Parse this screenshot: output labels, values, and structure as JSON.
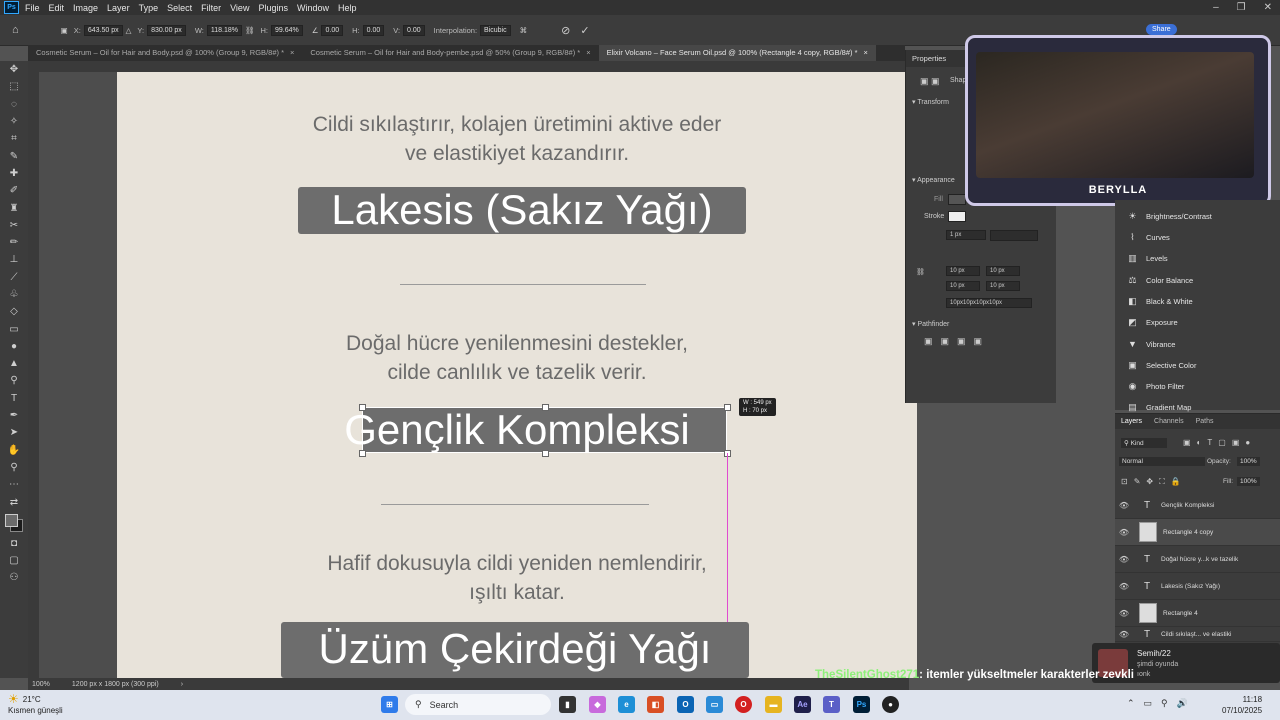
{
  "menu": [
    "File",
    "Edit",
    "Image",
    "Layer",
    "Type",
    "Select",
    "Filter",
    "View",
    "Plugins",
    "Window",
    "Help"
  ],
  "options": {
    "x_label": "X:",
    "x_value": "643.50 px",
    "y_label": "Y:",
    "y_value": "830.00 px",
    "w_label": "W:",
    "w_value": "118.18%",
    "h_label": "H:",
    "h_value": "99.64%",
    "angle_value": "0.00",
    "hskew_label": "H:",
    "hskew_value": "0.00",
    "vskew_label": "V:",
    "vskew_value": "0.00",
    "interp_label": "Interpolation:",
    "interp_value": "Bicubic"
  },
  "tabs": [
    {
      "label": "Cosmetic Serum – Oil for Hair and Body.psd @ 100% (Group 9, RGB/8#) *",
      "close": "×"
    },
    {
      "label": "Cosmetic Serum – Oil for Hair and Body-pembe.psd @ 50% (Group 9, RGB/8#) *",
      "close": "×"
    },
    {
      "label": "Elixir Volcano – Face Serum Oil.psd @ 100% (Rectangle 4 copy, RGB/8#) *",
      "close": "×"
    }
  ],
  "doc": {
    "p1_line1": "Cildi sıkılaştırır, kolajen üretimini aktive eder",
    "p1_line2": "ve elastikiyet kazandırır.",
    "h1": "Lakesis (Sakız Yağı)",
    "p2_line1": "Doğal hücre yenilenmesini destekler,",
    "p2_line2": "cilde canlılık ve tazelik verir.",
    "h2": "Gençlik Kompleksi",
    "p3_line1": "Hafif dokusuyla cildi yeniden nemlendirir,",
    "p3_line2": "ışıltı katar.",
    "h3": "Üzüm Çekirdeği Yağı",
    "size_w": "W : 549 px",
    "size_h": "H :  70 px"
  },
  "properties": {
    "tab": "Properties",
    "shape_label": "Shap",
    "transform": "Transform",
    "appearance": "Appearance",
    "fill": "Fill",
    "stroke": "Stroke",
    "stroke_width": "1 px",
    "corner1": "10 px",
    "corner2": "10 px",
    "corner3": "10 px",
    "corner4": "10 px",
    "corners_all": "10px10px10px10px",
    "pathfinder": "Pathfinder"
  },
  "adjustments": [
    "Brightness/Contrast",
    "Curves",
    "Levels",
    "Color Balance",
    "Black & White",
    "Exposure",
    "Vibrance",
    "Selective Color",
    "Photo Filter",
    "Gradient Map"
  ],
  "layers_panel": {
    "tabs": [
      "Layers",
      "Channels",
      "Paths"
    ],
    "kind": "Kind",
    "blend": "Normal",
    "opacity_label": "Opacity:",
    "opacity": "100%",
    "fill_label": "Fill:",
    "fill": "100%",
    "layers": [
      {
        "name": "Gençlik Kompleksi",
        "type": "T"
      },
      {
        "name": "Rectangle 4 copy",
        "type": "rect"
      },
      {
        "name": "Doğal hücre y...k ve tazelik",
        "type": "T"
      },
      {
        "name": "Lakesis (Sakız Yağı)",
        "type": "T"
      },
      {
        "name": "Rectangle 4",
        "type": "rect"
      },
      {
        "name": "Cildi sıkılaşt... ve elastiki",
        "type": "T"
      }
    ]
  },
  "status": {
    "zoom": "100%",
    "docsize": "1200 px x 1800 px (300 ppi)"
  },
  "stream": {
    "cam_name": "BERYLLA",
    "share": "Share",
    "chat_user": "TheSilentGhost271",
    "chat_msg": ": itemler yükseltmeler karakterler zevkli",
    "notif_name": "Semih/22",
    "notif_status": "şimdi oyunda",
    "notif_extra": "ıonk"
  },
  "taskbar": {
    "temp": "21°C",
    "weather": "Kısmen güneşli",
    "search": "Search",
    "time": "11:18",
    "date": "07/10/2025"
  }
}
